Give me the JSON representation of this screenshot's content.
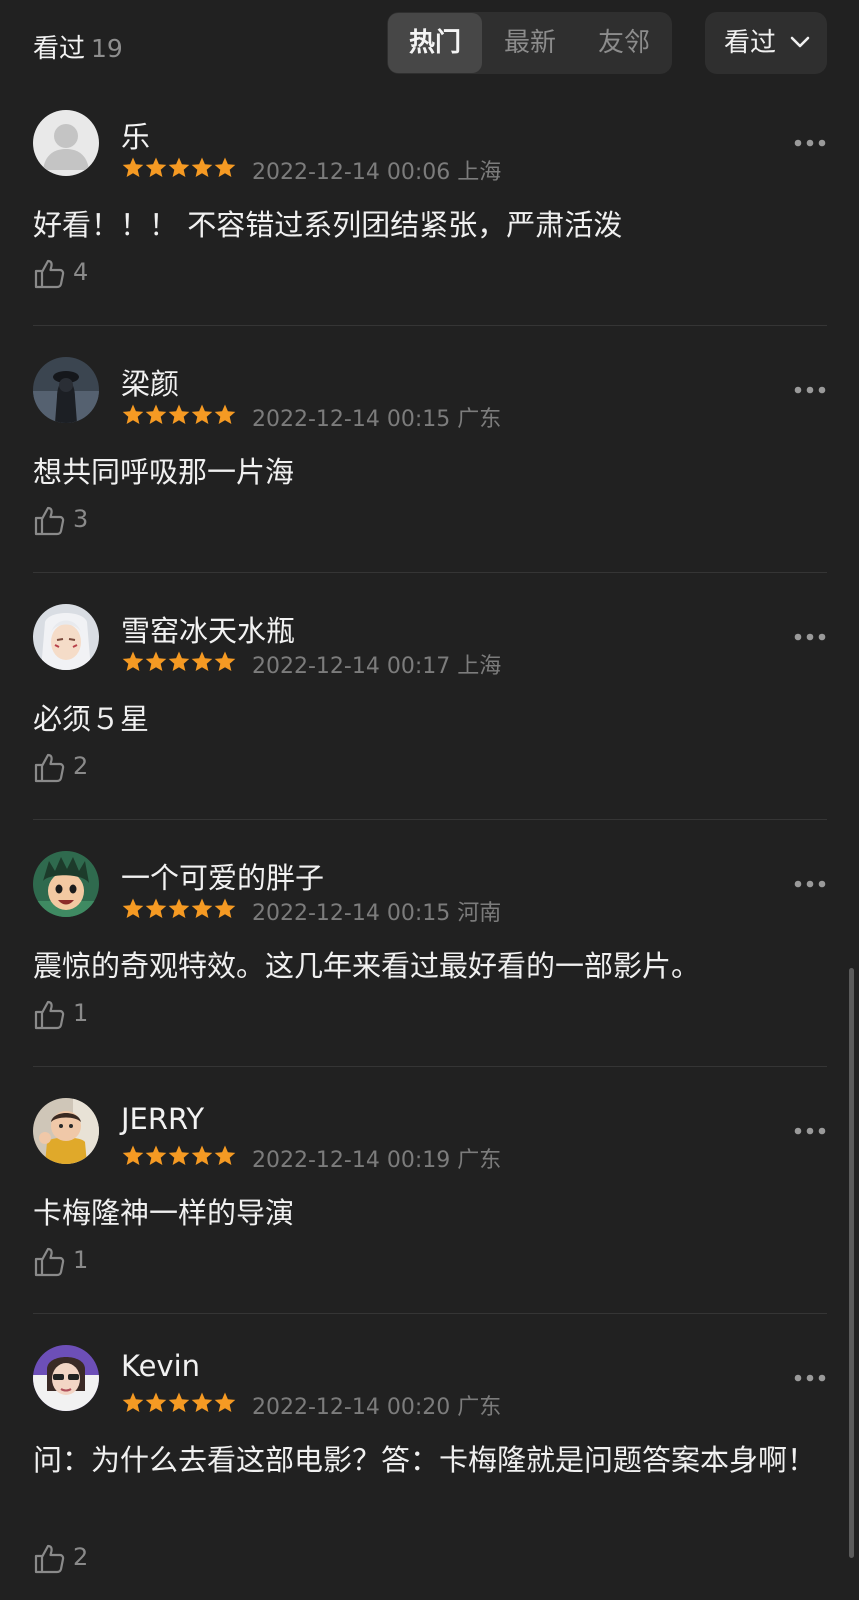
{
  "header": {
    "title": "看过",
    "count": "19",
    "tabs": [
      {
        "label": "热门"
      },
      {
        "label": "最新"
      },
      {
        "label": "友邻"
      }
    ],
    "filter_label": "看过"
  },
  "comments": [
    {
      "user": "乐",
      "stars": 5,
      "date": "2022-12-14 00:06",
      "location": "上海",
      "text": "好看！！！ 不容错过系列团结紧张，严肃活泼",
      "likes": "4"
    },
    {
      "user": "梁颜",
      "stars": 5,
      "date": "2022-12-14 00:15",
      "location": "广东",
      "text": "想共同呼吸那一片海",
      "likes": "3"
    },
    {
      "user": "雪窑冰天水瓶",
      "stars": 5,
      "date": "2022-12-14 00:17",
      "location": "上海",
      "text": "必须５星",
      "likes": "2"
    },
    {
      "user": "一个可爱的胖子",
      "stars": 5,
      "date": "2022-12-14 00:15",
      "location": "河南",
      "text": "震惊的奇观特效。这几年来看过最好看的一部影片。",
      "likes": "1"
    },
    {
      "user": "JERRY",
      "stars": 5,
      "date": "2022-12-14 00:19",
      "location": "广东",
      "text": "卡梅隆神一样的导演",
      "likes": "1"
    },
    {
      "user": "Kevin",
      "stars": 5,
      "date": "2022-12-14 00:20",
      "location": "广东",
      "text": "问：为什么去看这部电影？答：卡梅隆就是问题答案本身啊！",
      "likes": "2"
    }
  ],
  "colors": {
    "background": "#212121",
    "star": "#f59a23",
    "muted": "#7c7c7c",
    "text": "#f0f0f0"
  },
  "icons": {
    "star": "star-icon",
    "like": "thumbs-up-icon",
    "more": "more-horizontal-icon",
    "dropdown": "chevron-down-icon"
  }
}
